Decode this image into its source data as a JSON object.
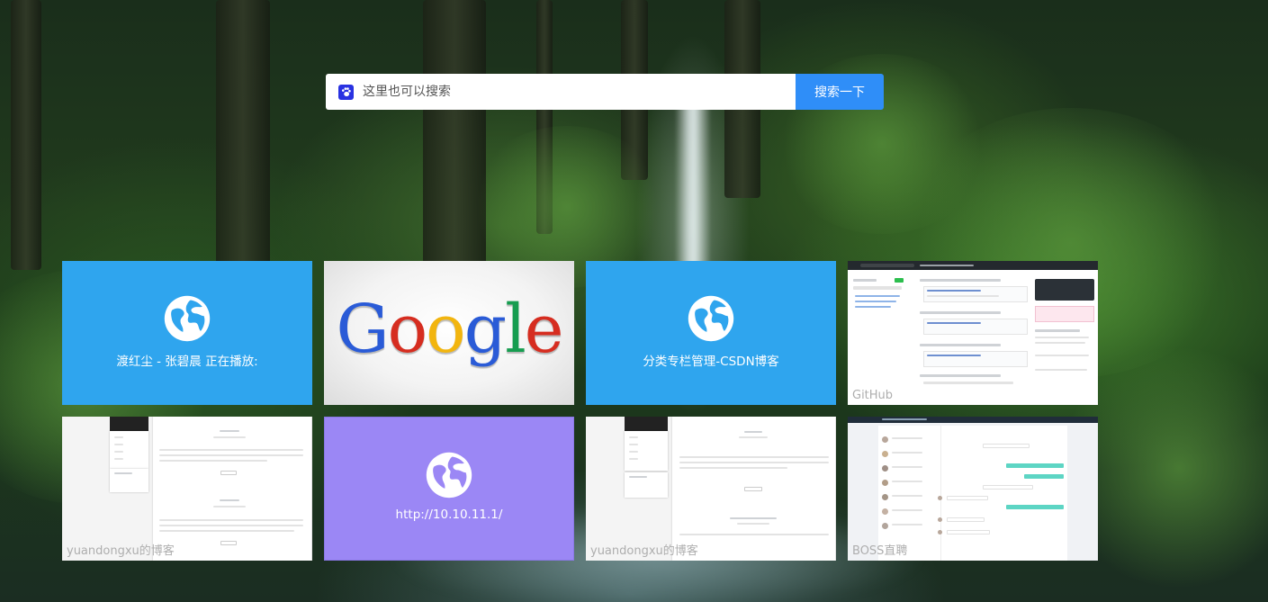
{
  "search": {
    "placeholder": "这里也可以搜索",
    "button_label": "搜索一下",
    "engine_icon": "baidu-paw-icon",
    "button_color": "#2f8ef8"
  },
  "tiles": [
    {
      "title": "渡红尘 - 张碧晨 正在播放:",
      "kind": "globe",
      "color": "#2fa5ee",
      "icon": "globe-icon"
    },
    {
      "title": "Google",
      "kind": "logo"
    },
    {
      "title": "分类专栏管理-CSDN博客",
      "kind": "globe",
      "color": "#2fa5ee",
      "icon": "globe-icon"
    },
    {
      "title": "GitHub",
      "kind": "screenshot"
    },
    {
      "title": "yuandongxu的博客",
      "kind": "screenshot"
    },
    {
      "title": "http://10.10.11.1/",
      "kind": "globe",
      "color": "#9b87f5",
      "icon": "globe-icon"
    },
    {
      "title": "yuandongxu的博客",
      "kind": "screenshot"
    },
    {
      "title": "BOSS直聘",
      "kind": "screenshot"
    }
  ],
  "colors": {
    "tile_blue": "#2fa5ee",
    "tile_purple": "#9b87f5"
  }
}
